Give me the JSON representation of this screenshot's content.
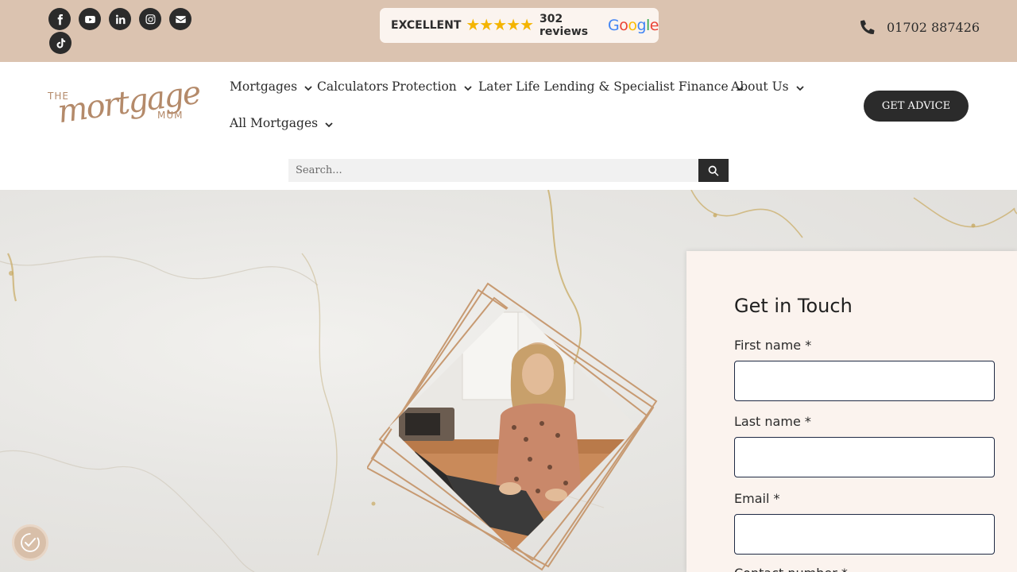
{
  "topbar": {
    "social_icons": [
      "facebook-icon",
      "youtube-icon",
      "linkedin-icon",
      "instagram-icon",
      "envelope-icon",
      "tiktok-icon"
    ],
    "review": {
      "label": "EXCELLENT",
      "stars": "★★★★★",
      "rating": 5,
      "count_text": "302 reviews",
      "provider": "Google"
    },
    "phone": "01702 887426"
  },
  "header": {
    "logo": {
      "the": "THE",
      "script": "mortgage",
      "mum": "MUM"
    },
    "nav": [
      {
        "label": "Mortgages",
        "has_dropdown": true
      },
      {
        "label": "Calculators",
        "has_dropdown": false
      },
      {
        "label": "Protection",
        "has_dropdown": true
      },
      {
        "label": "Later Life Lending & Specialist Finance",
        "has_dropdown": true
      },
      {
        "label": "About Us",
        "has_dropdown": true
      },
      {
        "label": "All Mortgages",
        "has_dropdown": true
      }
    ],
    "cta_label": "GET ADVICE",
    "search_placeholder": "Search..."
  },
  "form": {
    "title": "Get in Touch",
    "fields": [
      {
        "label": "First name *",
        "value": ""
      },
      {
        "label": "Last name *",
        "value": ""
      },
      {
        "label": "Email *",
        "value": ""
      },
      {
        "label": "Contact number *",
        "value": ""
      }
    ]
  },
  "colors": {
    "topbar_bg": "#dbc3b0",
    "dark": "#2b2b2b",
    "accent_gold": "#b48a6a",
    "form_bg": "#fbf3ee",
    "input_border": "#1f2a44"
  }
}
